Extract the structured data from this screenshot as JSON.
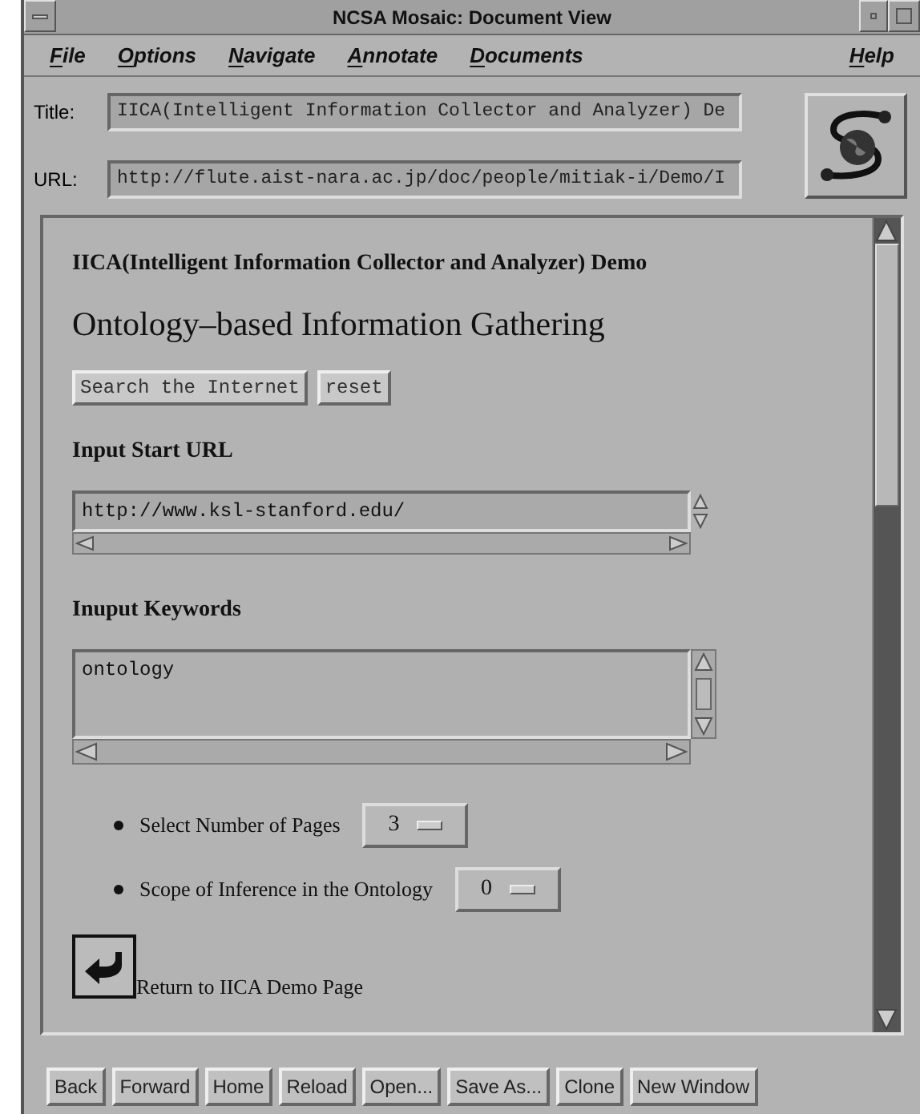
{
  "window": {
    "title": "NCSA Mosaic: Document View"
  },
  "menu": [
    {
      "label": "File"
    },
    {
      "label": "Options"
    },
    {
      "label": "Navigate"
    },
    {
      "label": "Annotate"
    },
    {
      "label": "Documents"
    },
    {
      "label": "Help"
    }
  ],
  "document": {
    "title_label": "Title:",
    "title": "IICA(Intelligent Information Collector and Analyzer) De",
    "url_label": "URL:",
    "url": "http://flute.aist-nara.ac.jp/doc/people/mitiak-i/Demo/I"
  },
  "page": {
    "heading": "IICA(Intelligent Information Collector and Analyzer) Demo",
    "title": "Ontology–based Information Gathering",
    "form_buttons": [
      "Search the Internet",
      "reset"
    ],
    "start_url": {
      "label": "Input Start URL",
      "value": "http://www.ksl-stanford.edu/"
    },
    "keywords": {
      "label": "Inuput Keywords",
      "value": "ontology"
    },
    "options": [
      {
        "label": "Select Number of Pages",
        "value": "3"
      },
      {
        "label": "Scope of Inference in the Ontology",
        "value": "0"
      }
    ],
    "return_link": "Return to IICA Demo Page"
  },
  "buttons": [
    "Back",
    "Forward",
    "Home",
    "Reload",
    "Open...",
    "Save As...",
    "Clone",
    "New Window"
  ]
}
